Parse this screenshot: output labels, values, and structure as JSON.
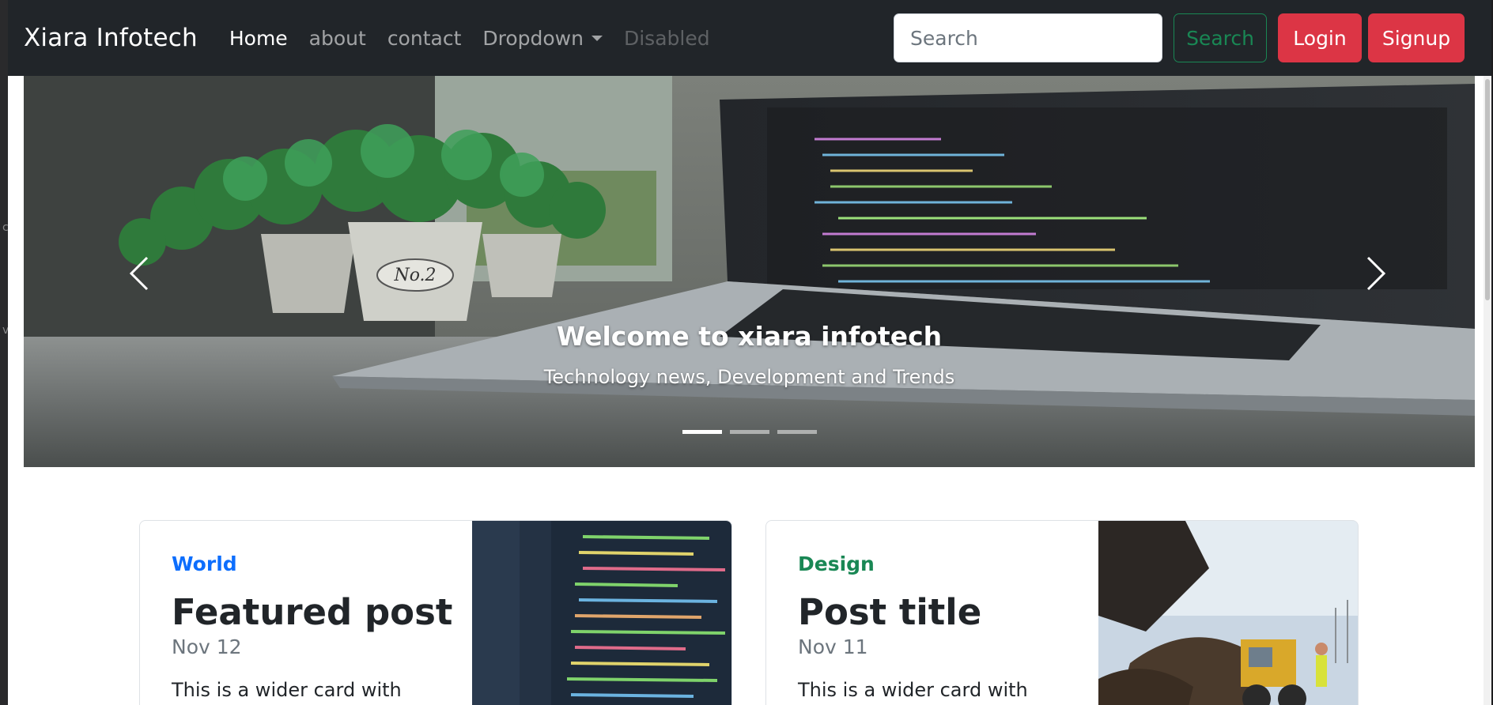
{
  "navbar": {
    "brand": "Xiara Infotech",
    "links": [
      {
        "label": "Home"
      },
      {
        "label": "about"
      },
      {
        "label": "contact"
      },
      {
        "label": "Dropdown"
      },
      {
        "label": "Disabled"
      }
    ],
    "search_placeholder": "Search",
    "search_button": "Search",
    "login_button": "Login",
    "signup_button": "Signup"
  },
  "carousel": {
    "caption_title": "Welcome to xiara infotech",
    "caption_text": "Technology news, Development and Trends",
    "slide_count": 3,
    "active_slide": 1
  },
  "cards": [
    {
      "category": "World",
      "title": "Featured post",
      "date": "Nov 12",
      "text": "This is a wider card with"
    },
    {
      "category": "Design",
      "title": "Post title",
      "date": "Nov 11",
      "text": "This is a wider card with"
    }
  ],
  "colors": {
    "navbar_bg": "#212529",
    "danger": "#dc3545",
    "success": "#198754",
    "primary": "#0d6efd"
  }
}
